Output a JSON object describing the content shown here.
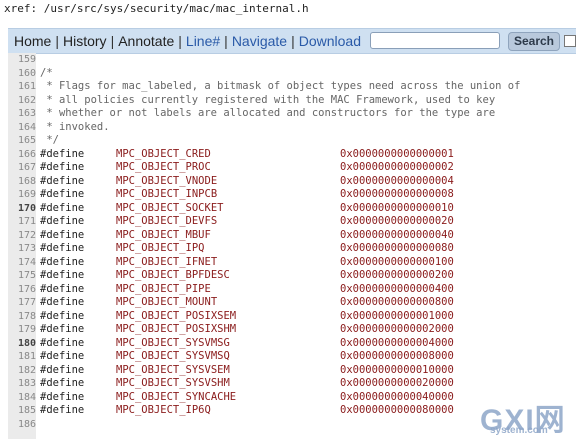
{
  "xref": "xref: /usr/src/sys/security/mac/mac_internal.h",
  "nav": {
    "home": "Home",
    "history": "History",
    "annotate": "Annotate",
    "line": "Line#",
    "navigate": "Navigate",
    "download": "Download",
    "search_button": "Search",
    "search_value": "",
    "sep": "|"
  },
  "code_lines": [
    {
      "n": "159",
      "bold": false,
      "comment": ""
    },
    {
      "n": "160",
      "bold": false,
      "comment": "/*"
    },
    {
      "n": "161",
      "bold": false,
      "comment": " * Flags for mac_labeled, a bitmask of object types need across the union of"
    },
    {
      "n": "162",
      "bold": false,
      "comment": " * all policies currently registered with the MAC Framework, used to key"
    },
    {
      "n": "163",
      "bold": false,
      "comment": " * whether or not labels are allocated and constructors for the type are"
    },
    {
      "n": "164",
      "bold": false,
      "comment": " * invoked."
    },
    {
      "n": "165",
      "bold": false,
      "comment": " */"
    },
    {
      "n": "166",
      "bold": false,
      "kw": "#define",
      "sym": "MPC_OBJECT_CRED",
      "val": "0x0000000000000001"
    },
    {
      "n": "167",
      "bold": false,
      "kw": "#define",
      "sym": "MPC_OBJECT_PROC",
      "val": "0x0000000000000002"
    },
    {
      "n": "168",
      "bold": false,
      "kw": "#define",
      "sym": "MPC_OBJECT_VNODE",
      "val": "0x0000000000000004"
    },
    {
      "n": "169",
      "bold": false,
      "kw": "#define",
      "sym": "MPC_OBJECT_INPCB",
      "val": "0x0000000000000008"
    },
    {
      "n": "170",
      "bold": true,
      "kw": "#define",
      "sym": "MPC_OBJECT_SOCKET",
      "val": "0x0000000000000010"
    },
    {
      "n": "171",
      "bold": false,
      "kw": "#define",
      "sym": "MPC_OBJECT_DEVFS",
      "val": "0x0000000000000020"
    },
    {
      "n": "172",
      "bold": false,
      "kw": "#define",
      "sym": "MPC_OBJECT_MBUF",
      "val": "0x0000000000000040"
    },
    {
      "n": "173",
      "bold": false,
      "kw": "#define",
      "sym": "MPC_OBJECT_IPQ",
      "val": "0x0000000000000080"
    },
    {
      "n": "174",
      "bold": false,
      "kw": "#define",
      "sym": "MPC_OBJECT_IFNET",
      "val": "0x0000000000000100"
    },
    {
      "n": "175",
      "bold": false,
      "kw": "#define",
      "sym": "MPC_OBJECT_BPFDESC",
      "val": "0x0000000000000200"
    },
    {
      "n": "176",
      "bold": false,
      "kw": "#define",
      "sym": "MPC_OBJECT_PIPE",
      "val": "0x0000000000000400"
    },
    {
      "n": "177",
      "bold": false,
      "kw": "#define",
      "sym": "MPC_OBJECT_MOUNT",
      "val": "0x0000000000000800"
    },
    {
      "n": "178",
      "bold": false,
      "kw": "#define",
      "sym": "MPC_OBJECT_POSIXSEM",
      "val": "0x0000000000001000"
    },
    {
      "n": "179",
      "bold": false,
      "kw": "#define",
      "sym": "MPC_OBJECT_POSIXSHM",
      "val": "0x0000000000002000"
    },
    {
      "n": "180",
      "bold": true,
      "kw": "#define",
      "sym": "MPC_OBJECT_SYSVMSG",
      "val": "0x0000000000004000"
    },
    {
      "n": "181",
      "bold": false,
      "kw": "#define",
      "sym": "MPC_OBJECT_SYSVMSQ",
      "val": "0x0000000000008000"
    },
    {
      "n": "182",
      "bold": false,
      "kw": "#define",
      "sym": "MPC_OBJECT_SYSVSEM",
      "val": "0x0000000000010000"
    },
    {
      "n": "183",
      "bold": false,
      "kw": "#define",
      "sym": "MPC_OBJECT_SYSVSHM",
      "val": "0x0000000000020000"
    },
    {
      "n": "184",
      "bold": false,
      "kw": "#define",
      "sym": "MPC_OBJECT_SYNCACHE",
      "val": "0x0000000000040000"
    },
    {
      "n": "185",
      "bold": false,
      "kw": "#define",
      "sym": "MPC_OBJECT_IP6Q",
      "val": "0x0000000000080000"
    },
    {
      "n": "186",
      "bold": false,
      "comment": ""
    }
  ],
  "watermark": {
    "main": "GXI网",
    "sub": "system.com"
  }
}
